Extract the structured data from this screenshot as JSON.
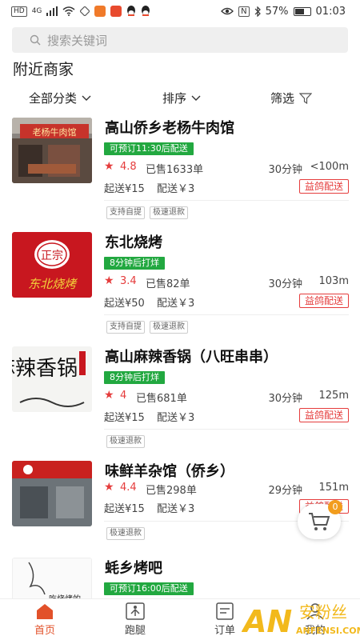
{
  "status_bar": {
    "hd_badge": "HD",
    "network": "4G",
    "battery_percent": "57%",
    "time": "01:03",
    "nfc": "N"
  },
  "search": {
    "placeholder": "搜索关键词"
  },
  "section_title": "附近商家",
  "filters": {
    "category": "全部分类",
    "sort": "排序",
    "filter": "筛选"
  },
  "shops": [
    {
      "name": "高山侨乡老杨牛肉馆",
      "status_tag": "可预订11:30后配送",
      "rating": "4.8",
      "sold": "已售1633单",
      "time": "30分钟",
      "distance": "<100m",
      "min_order": "起送¥15",
      "delivery_fee": "配送￥3",
      "delivery_badge": "益鸽配送",
      "feature_tags": [
        "支持自提",
        "极速退款"
      ],
      "image_sign_text": "老杨牛肉馆"
    },
    {
      "name": "东北烧烤",
      "status_tag": "8分钟后打烊",
      "rating": "3.4",
      "sold": "已售82单",
      "time": "30分钟",
      "distance": "103m",
      "min_order": "起送¥50",
      "delivery_fee": "配送￥3",
      "delivery_badge": "益鸽配送",
      "feature_tags": [
        "支持自提",
        "极速退款"
      ],
      "image_logo_top": "正宗",
      "image_logo_bottom": "东北烧烤"
    },
    {
      "name": "高山麻辣香锅（八旺串串）",
      "status_tag": "8分钟后打烊",
      "rating": "4",
      "sold": "已售681单",
      "time": "30分钟",
      "distance": "125m",
      "min_order": "起送¥15",
      "delivery_fee": "配送￥3",
      "delivery_badge": "益鸽配送",
      "feature_tags": [
        "极速退款"
      ],
      "image_logo_text": "麻辣香锅"
    },
    {
      "name": "味鲜羊杂馆（侨乡）",
      "status_tag": "",
      "rating": "4.4",
      "sold": "已售298单",
      "time": "29分钟",
      "distance": "151m",
      "min_order": "起送¥15",
      "delivery_fee": "配送￥3",
      "delivery_badge": "益鸽配送",
      "feature_tags": [
        "极速退款"
      ]
    },
    {
      "name": "蚝乡烤吧",
      "status_tag": "可预订16:00后配送",
      "image_caption": "吃烧烤的"
    }
  ],
  "cart": {
    "count": "0"
  },
  "tabs": [
    {
      "label": "首页",
      "icon": "home-icon",
      "active": true
    },
    {
      "label": "跑腿",
      "icon": "errand-icon",
      "active": false
    },
    {
      "label": "订单",
      "icon": "order-icon",
      "active": false
    },
    {
      "label": "我的",
      "icon": "profile-icon",
      "active": false
    }
  ],
  "watermark": {
    "logo": "AN",
    "title": "安粉丝",
    "url": "ANFENSI.COM"
  },
  "colors": {
    "accent_red": "#e53c3c",
    "green_tag": "#22a840",
    "tab_active": "#e2512a",
    "cart_badge": "#f29d1d"
  }
}
